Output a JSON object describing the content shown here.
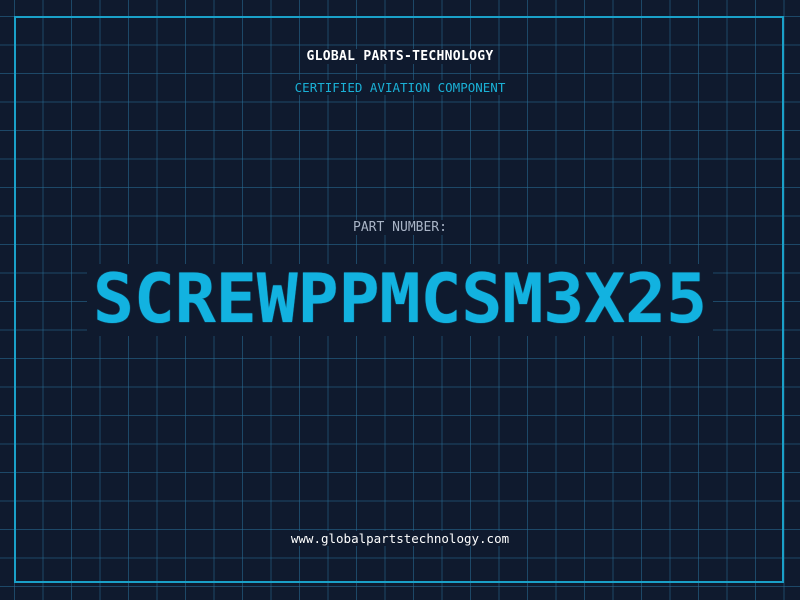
{
  "header": {
    "company": "GLOBAL PARTS-TECHNOLOGY",
    "tagline": "CERTIFIED AVIATION COMPONENT"
  },
  "part": {
    "label": "PART NUMBER:",
    "number": "SCREWPPMCSM3X25"
  },
  "footer": {
    "website": "www.globalpartstechnology.com"
  },
  "colors": {
    "background": "#0f1a2e",
    "grid": "#286e96",
    "accent": "#12b2e0",
    "frame": "#1aa0c8",
    "text_primary": "#ffffff",
    "text_secondary": "#a9b4c6"
  }
}
